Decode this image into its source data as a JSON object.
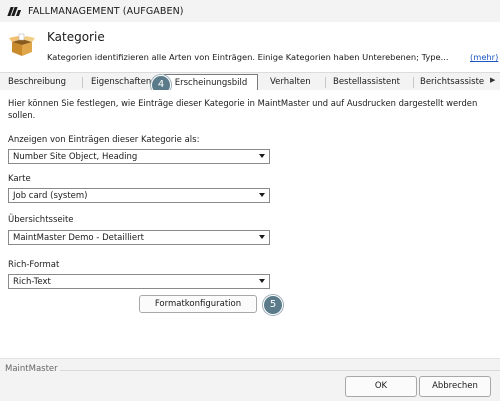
{
  "window": {
    "title": "FALLMANAGEMENT (AUFGABEN)"
  },
  "header": {
    "title": "Kategorie",
    "description": "Kategorien identifizieren alle Arten von Einträgen. Einige Kategorien haben Unterebenen; Type...",
    "more_link": "(mehr)"
  },
  "tabs": [
    {
      "label": "Beschreibung"
    },
    {
      "label": "Eigenschaften"
    },
    {
      "label": "Erscheinungsbild"
    },
    {
      "label": "Verhalten"
    },
    {
      "label": "Bestellassistent"
    },
    {
      "label": "Berichtsassiste"
    }
  ],
  "active_tab": "Erscheinungsbild",
  "content": {
    "intro": "Hier können Sie festlegen, wie Einträge dieser Kategorie in MaintMaster und auf Ausdrucken dargestellt werden sollen.",
    "fields": [
      {
        "label": "Anzeigen von Einträgen dieser Kategorie als:",
        "value": "Number Site Object, Heading"
      },
      {
        "label": "Karte",
        "value": "Job card (system)"
      },
      {
        "label": "Übersichtsseite",
        "value": "MaintMaster Demo - Detailliert"
      },
      {
        "label": "Rich-Format",
        "value": "Rich-Text"
      }
    ],
    "format_button": "Formatkonfiguration"
  },
  "badges": {
    "tab_marker": "4",
    "button_marker": "5"
  },
  "footer": {
    "brand": "MaintMaster",
    "ok": "OK",
    "cancel": "Abbrechen"
  },
  "colors": {
    "badge": "#5b7b8a",
    "link": "#1a56c4",
    "titlebar": "#f3f3f3"
  },
  "icons": {
    "app_logo": "maintmaster-logo-icon",
    "category": "open-box-icon",
    "dropdown": "chevron-down-icon"
  }
}
